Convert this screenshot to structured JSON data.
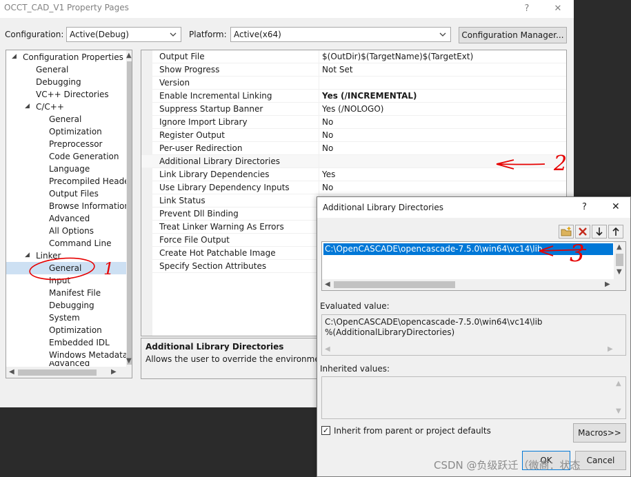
{
  "window": {
    "title": "OCCT_CAD_V1 Property Pages",
    "help_glyph": "?",
    "close_glyph": "✕"
  },
  "config": {
    "configuration_label": "Configuration:",
    "configuration_value": "Active(Debug)",
    "platform_label": "Platform:",
    "platform_value": "Active(x64)",
    "manager_label": "Configuration Manager..."
  },
  "tree": {
    "items": [
      {
        "label": "Configuration Properties"
      },
      {
        "label": "General"
      },
      {
        "label": "Debugging"
      },
      {
        "label": "VC++ Directories"
      },
      {
        "label": "C/C++"
      },
      {
        "label": "General"
      },
      {
        "label": "Optimization"
      },
      {
        "label": "Preprocessor"
      },
      {
        "label": "Code Generation"
      },
      {
        "label": "Language"
      },
      {
        "label": "Precompiled Heade"
      },
      {
        "label": "Output Files"
      },
      {
        "label": "Browse Information"
      },
      {
        "label": "Advanced"
      },
      {
        "label": "All Options"
      },
      {
        "label": "Command Line"
      },
      {
        "label": "Linker"
      },
      {
        "label": "General"
      },
      {
        "label": "Input"
      },
      {
        "label": "Manifest File"
      },
      {
        "label": "Debugging"
      },
      {
        "label": "System"
      },
      {
        "label": "Optimization"
      },
      {
        "label": "Embedded IDL"
      },
      {
        "label": "Windows Metadata"
      },
      {
        "label": "Advanced"
      }
    ]
  },
  "grid": {
    "rows": [
      {
        "name": "Output File",
        "value": "$(OutDir)$(TargetName)$(TargetExt)"
      },
      {
        "name": "Show Progress",
        "value": "Not Set"
      },
      {
        "name": "Version",
        "value": ""
      },
      {
        "name": "Enable Incremental Linking",
        "value": "Yes (/INCREMENTAL)"
      },
      {
        "name": "Suppress Startup Banner",
        "value": "Yes (/NOLOGO)"
      },
      {
        "name": "Ignore Import Library",
        "value": "No"
      },
      {
        "name": "Register Output",
        "value": "No"
      },
      {
        "name": "Per-user Redirection",
        "value": "No"
      },
      {
        "name": "Additional Library Directories",
        "value": ""
      },
      {
        "name": "Link Library Dependencies",
        "value": "Yes"
      },
      {
        "name": "Use Library Dependency Inputs",
        "value": "No"
      },
      {
        "name": "Link Status",
        "value": ""
      },
      {
        "name": "Prevent Dll Binding",
        "value": ""
      },
      {
        "name": "Treat Linker Warning As Errors",
        "value": ""
      },
      {
        "name": "Force File Output",
        "value": ""
      },
      {
        "name": "Create Hot Patchable Image",
        "value": ""
      },
      {
        "name": "Specify Section Attributes",
        "value": ""
      }
    ]
  },
  "description": {
    "title": "Additional Library Directories",
    "text": "Allows the user to override the environmental li"
  },
  "dialog": {
    "title": "Additional Library Directories",
    "help_glyph": "?",
    "close_glyph": "✕",
    "list_item": "C:\\OpenCASCADE\\opencascade-7.5.0\\win64\\vc14\\lib",
    "evaluated_label": "Evaluated value:",
    "evaluated_line1": "C:\\OpenCASCADE\\opencascade-7.5.0\\win64\\vc14\\lib",
    "evaluated_line2": "%(AdditionalLibraryDirectories)",
    "inherited_label": "Inherited values:",
    "inherit_checkbox": "Inherit from parent or project defaults",
    "check_glyph": "✓",
    "macros_label": "Macros>>",
    "ok_label": "OK",
    "cancel_label": "Cancel"
  },
  "watermark": "CSDN @负级跃迁（微商：状态",
  "annotations": {
    "arrow2_number": "2",
    "arrow3_number": "3",
    "mark1_number": "1"
  },
  "colors": {
    "selection": "#0078d7",
    "tree_selection": "#cde0f3",
    "annotation": "#e60000"
  }
}
